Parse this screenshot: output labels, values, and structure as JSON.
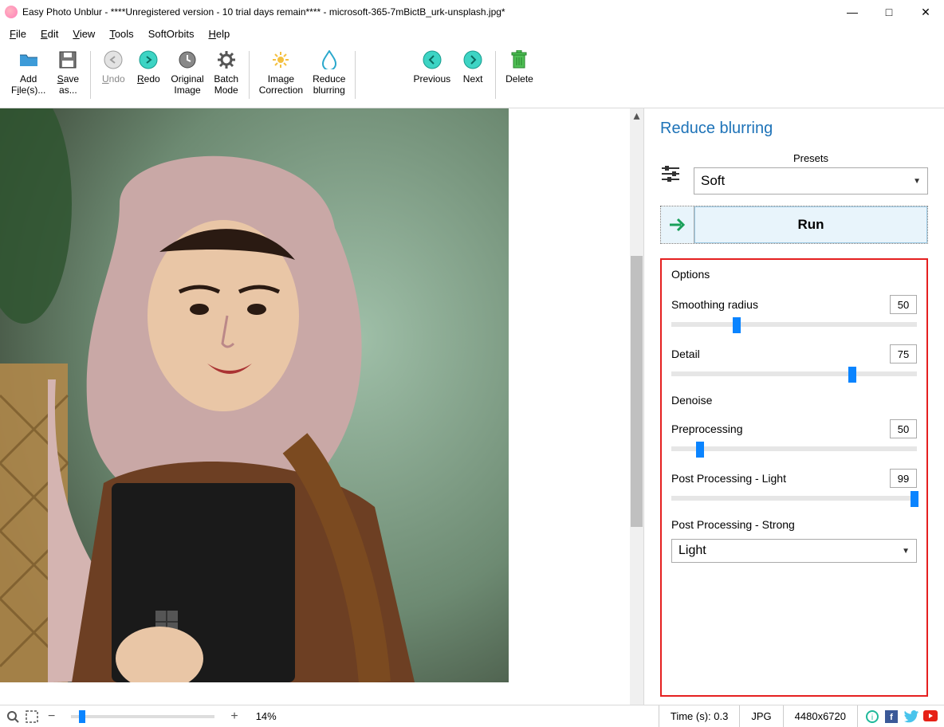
{
  "title": "Easy Photo Unblur - ****Unregistered version - 10 trial days remain**** - microsoft-365-7mBictB_urk-unsplash.jpg*",
  "menu": {
    "file": "File",
    "edit": "Edit",
    "view": "View",
    "tools": "Tools",
    "softorbits": "SoftOrbits",
    "help": "Help"
  },
  "toolbar": {
    "add_files": "Add\nFile(s)...",
    "save_as": "Save\nas...",
    "undo": "Undo",
    "redo": "Redo",
    "original": "Original\nImage",
    "batch": "Batch\nMode",
    "image_corr": "Image\nCorrection",
    "reduce": "Reduce\nblurring",
    "previous": "Previous",
    "next": "Next",
    "delete": "Delete"
  },
  "panel": {
    "title": "Reduce blurring",
    "presets_label": "Presets",
    "preset_value": "Soft",
    "run": "Run",
    "options": "Options",
    "smoothing": {
      "label": "Smoothing radius",
      "value": "50",
      "pct": 25
    },
    "detail": {
      "label": "Detail",
      "value": "75",
      "pct": 72
    },
    "denoise_header": "Denoise",
    "pre": {
      "label": "Preprocessing",
      "value": "50",
      "pct": 10
    },
    "post_light": {
      "label": "Post Processing - Light",
      "value": "99",
      "pct": 99
    },
    "post_strong_label": "Post Processing - Strong",
    "post_strong_value": "Light"
  },
  "status": {
    "zoom": "14%",
    "time": "Time (s): 0.3",
    "format": "JPG",
    "dims": "4480x6720"
  }
}
